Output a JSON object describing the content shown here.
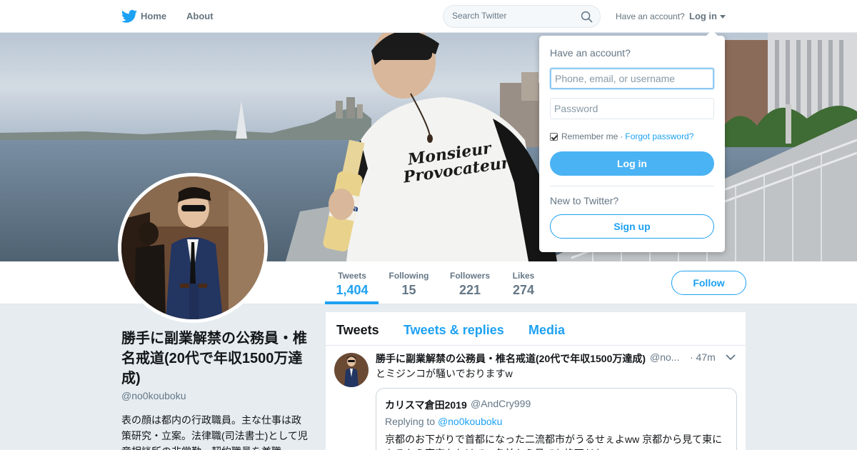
{
  "nav": {
    "home_label": "Home",
    "about_label": "About",
    "search_placeholder": "Search Twitter",
    "have_account_text": "Have an account?",
    "login_label": "Log in"
  },
  "profile": {
    "name": "勝手に副業解禁の公務員・椎名戒道(20代で年収1500万達成)",
    "handle": "@no0kouboku",
    "bio": "表の顔は都内の行政職員。主な仕事は政策研究・立案。法律職(司法書士)として児童相談所の非常勤・契約職員を兼職",
    "follow_label": "Follow",
    "stats": [
      {
        "label": "Tweets",
        "value": "1,404"
      },
      {
        "label": "Following",
        "value": "15"
      },
      {
        "label": "Followers",
        "value": "221"
      },
      {
        "label": "Likes",
        "value": "274"
      }
    ],
    "banner_shirt_text": [
      "Monsieur",
      "Provocateur"
    ],
    "banner_bottle_text": "orona"
  },
  "timeline": {
    "tabs": [
      "Tweets",
      "Tweets & replies",
      "Media"
    ],
    "tweet": {
      "name": "勝手に副業解禁の公務員・椎名戒道(20代で年収1500万達成)",
      "handle": "@no...",
      "time": "· 47m",
      "text": "とミジンコが騒いでおりますw",
      "quote": {
        "name": "カリスマ倉田2019",
        "handle": "@AndCry999",
        "replying_prefix": "Replying to ",
        "replying_to": "@no0kouboku",
        "text": "京都のお下がりで首都になった二流都市がうるせぇよww 京都から見て東にあるから東京なわけで、名前から見ても格下だなwww"
      }
    }
  },
  "login_dropdown": {
    "title": "Have an account?",
    "username_placeholder": "Phone, email, or username",
    "password_placeholder": "Password",
    "remember_label": "Remember me",
    "separator": "·",
    "forgot_label": "Forgot password?",
    "login_button": "Log in",
    "new_prompt": "New to Twitter?",
    "signup_button": "Sign up"
  },
  "colors": {
    "accent": "#1da1f2",
    "login_button_bg": "#4ab3f4",
    "page_bg": "#e6ecf0",
    "muted_text": "#657786"
  }
}
